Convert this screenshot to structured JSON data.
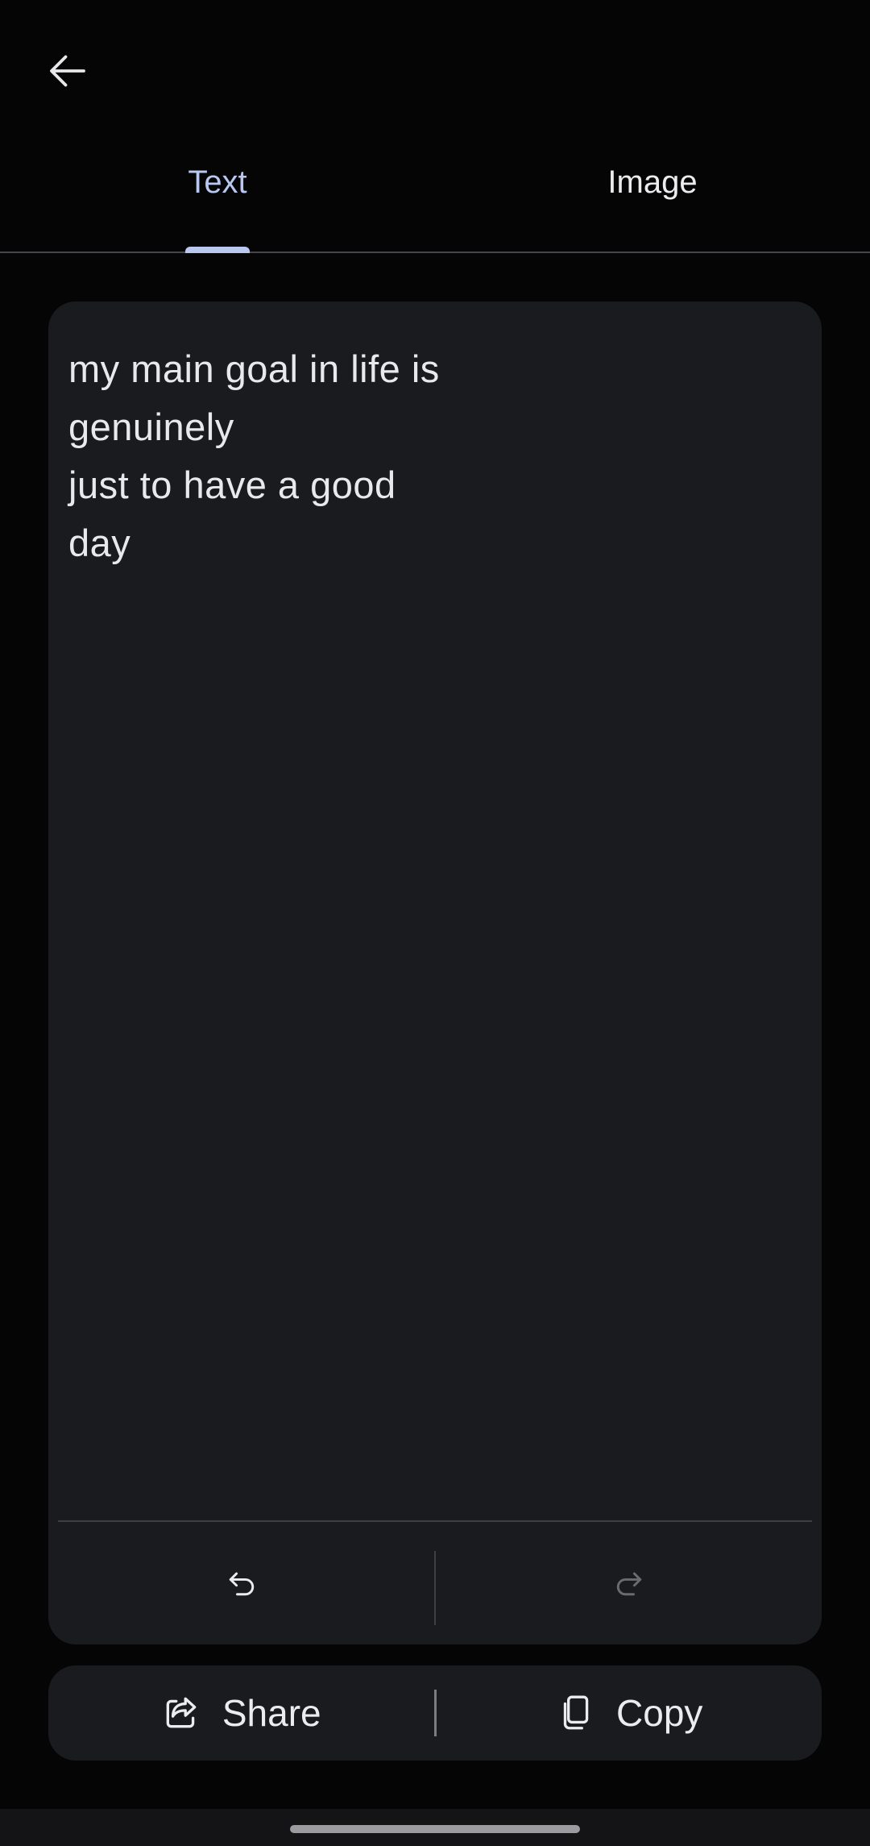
{
  "header": {
    "back_icon": "arrow-left-icon"
  },
  "tabs": [
    {
      "label": "Text",
      "active": true
    },
    {
      "label": "Image",
      "active": false
    }
  ],
  "editor": {
    "text": "my main goal in life is\ngenuinely\njust to have a good\nday",
    "undo_icon": "undo-icon",
    "redo_icon": "redo-icon"
  },
  "actions": {
    "share_label": "Share",
    "share_icon": "share-icon",
    "copy_label": "Copy",
    "copy_icon": "copy-icon"
  },
  "colors": {
    "background": "#050506",
    "card": "#1a1b1e",
    "accent": "#b9c8ef"
  }
}
